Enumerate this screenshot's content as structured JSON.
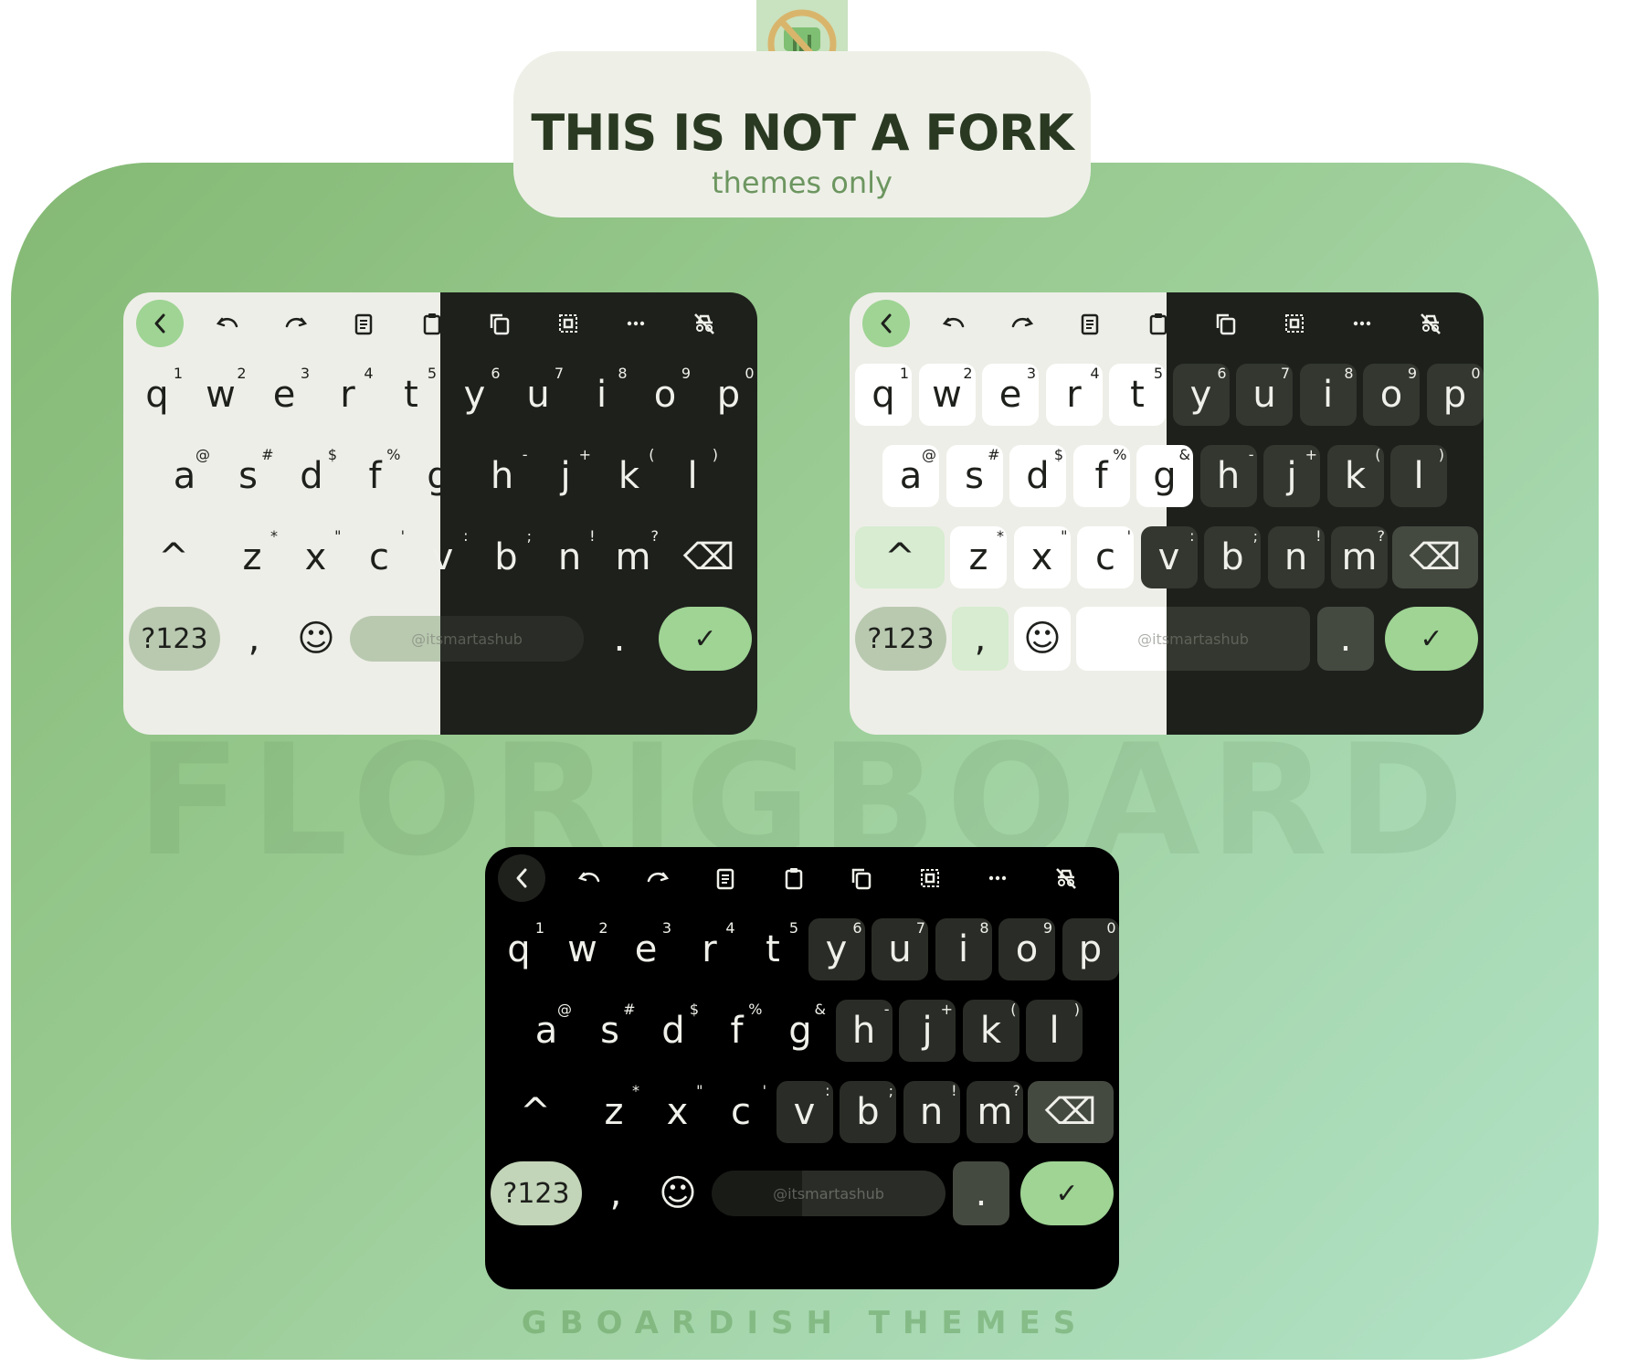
{
  "header": {
    "title": "THIS IS NOT A FORK",
    "subtitle": "themes only"
  },
  "watermark": "FLORIGBOARD",
  "footer": "GBOARDISH THEMES",
  "keyboard": {
    "toolbar_icons": [
      "back-icon",
      "undo-icon",
      "redo-icon",
      "clipboard-icon",
      "paste-icon",
      "copy-icon",
      "select-all-icon",
      "more-icon",
      "incognito-icon"
    ],
    "rows": [
      [
        {
          "k": "q",
          "h": "1"
        },
        {
          "k": "w",
          "h": "2"
        },
        {
          "k": "e",
          "h": "3"
        },
        {
          "k": "r",
          "h": "4"
        },
        {
          "k": "t",
          "h": "5"
        },
        {
          "k": "y",
          "h": "6"
        },
        {
          "k": "u",
          "h": "7"
        },
        {
          "k": "i",
          "h": "8"
        },
        {
          "k": "o",
          "h": "9"
        },
        {
          "k": "p",
          "h": "0"
        }
      ],
      [
        {
          "k": "a",
          "h": "@"
        },
        {
          "k": "s",
          "h": "#"
        },
        {
          "k": "d",
          "h": "$"
        },
        {
          "k": "f",
          "h": "%"
        },
        {
          "k": "g",
          "h": "&"
        },
        {
          "k": "h",
          "h": "-"
        },
        {
          "k": "j",
          "h": "+"
        },
        {
          "k": "k",
          "h": "("
        },
        {
          "k": "l",
          "h": ")"
        }
      ],
      [
        {
          "k": "z",
          "h": "*"
        },
        {
          "k": "x",
          "h": "\""
        },
        {
          "k": "c",
          "h": "'"
        },
        {
          "k": "v",
          "h": ":"
        },
        {
          "k": "b",
          "h": ";"
        },
        {
          "k": "n",
          "h": "!"
        },
        {
          "k": "m",
          "h": "?"
        }
      ]
    ],
    "shift_label": "^",
    "symbols_label": "?123",
    "comma_label": ",",
    "period_label": ".",
    "space_label": "@itsmartashub",
    "emoji_label": "☺",
    "enter_label": "✓",
    "backspace_label": "⌫"
  },
  "themes": [
    {
      "id": "light-borderless",
      "left": {
        "bg": "#eeeee8",
        "fg": "#1e201c",
        "key_bg": "transparent",
        "accent": "#9fd494",
        "space": "#b9c9b0"
      },
      "right": {
        "bg": "#1e201c",
        "fg": "#f0f0ea",
        "key_bg": "transparent",
        "space": "#2a2d27"
      }
    },
    {
      "id": "light-bordered",
      "left": {
        "bg": "#eeeee8",
        "fg": "#1e201c",
        "key_bg": "#ffffff",
        "accent": "#9fd494",
        "space": "#ffffff",
        "mod": "#d7ecd0"
      },
      "right": {
        "bg": "#1e201c",
        "fg": "#f0f0ea",
        "key_bg": "#33372f",
        "space": "#33372f",
        "mod": "#454a41"
      }
    },
    {
      "id": "amoled",
      "left": {
        "bg": "#000000",
        "fg": "#f0f0ea",
        "key_bg": "transparent",
        "accent": "#9fd494",
        "space": "#191b17"
      },
      "right": {
        "bg": "#000000",
        "fg": "#f0f0ea",
        "key_bg": "#2a2d27",
        "space": "#2a2d27",
        "mod": "#454a41"
      }
    }
  ]
}
